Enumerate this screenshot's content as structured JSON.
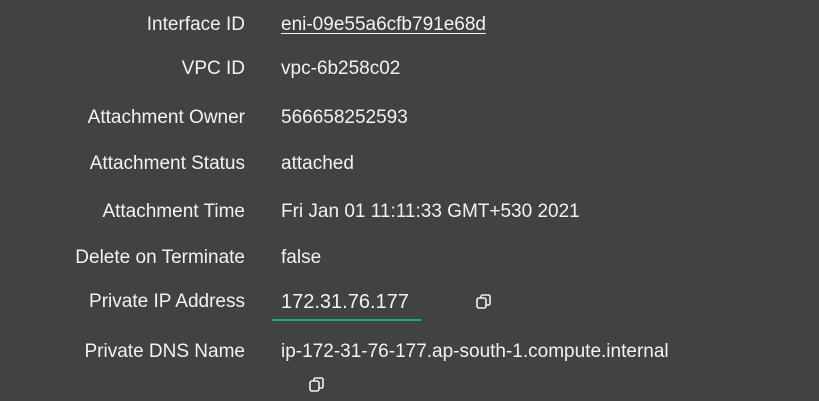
{
  "details": {
    "rows": [
      {
        "label": "Interface ID",
        "value": "eni-09e55a6cfb791e68d"
      },
      {
        "label": "VPC ID",
        "value": "vpc-6b258c02"
      },
      {
        "label": "Attachment Owner",
        "value": "566658252593"
      },
      {
        "label": "Attachment Status",
        "value": "attached"
      },
      {
        "label": "Attachment Time",
        "value": "Fri Jan 01 11:11:33 GMT+530 2021"
      },
      {
        "label": "Delete on Terminate",
        "value": "false"
      },
      {
        "label": "Private IP Address",
        "value": "172.31.76.177"
      },
      {
        "label": "Private DNS Name",
        "value": "ip-172-31-76-177.ap-south-1.compute.internal"
      }
    ]
  },
  "icons": {
    "ip_copy": "copy-icon",
    "dns_copy": "copy-icon"
  },
  "colors": {
    "background": "#424242",
    "text": "#f2f2f2",
    "highlight_underline": "#1aa68a"
  }
}
